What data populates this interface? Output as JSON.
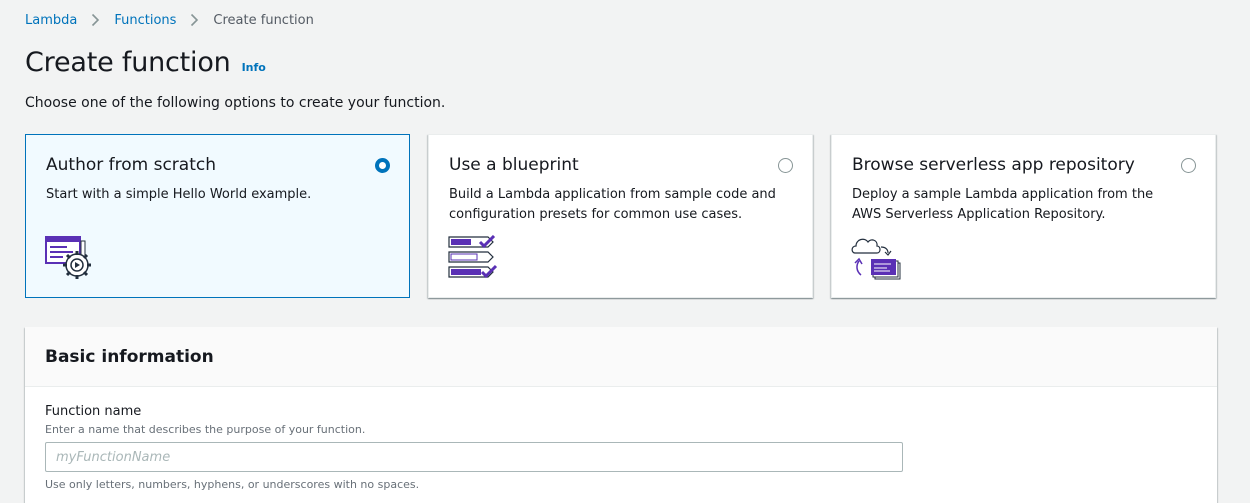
{
  "breadcrumb": {
    "items": [
      "Lambda",
      "Functions"
    ],
    "current": "Create function"
  },
  "header": {
    "title": "Create function",
    "info": "Info"
  },
  "description": "Choose one of the following options to create your function.",
  "options": [
    {
      "title": "Author from scratch",
      "desc": "Start with a simple Hello World example.",
      "selected": true,
      "icon": "code-gear-icon"
    },
    {
      "title": "Use a blueprint",
      "desc": "Build a Lambda application from sample code and configuration presets for common use cases.",
      "selected": false,
      "icon": "blueprint-checklist-icon"
    },
    {
      "title": "Browse serverless app repository",
      "desc": "Deploy a sample Lambda application from the AWS Serverless Application Repository.",
      "selected": false,
      "icon": "cloud-repository-icon"
    }
  ],
  "basic_info": {
    "title": "Basic information",
    "function_name": {
      "label": "Function name",
      "description": "Enter a name that describes the purpose of your function.",
      "placeholder": "myFunctionName",
      "value": "",
      "hint": "Use only letters, numbers, hyphens, or underscores with no spaces."
    }
  },
  "colors": {
    "link": "#0073bb",
    "selected_bg": "#f1faff",
    "icon_purple": "#5a30b5"
  }
}
